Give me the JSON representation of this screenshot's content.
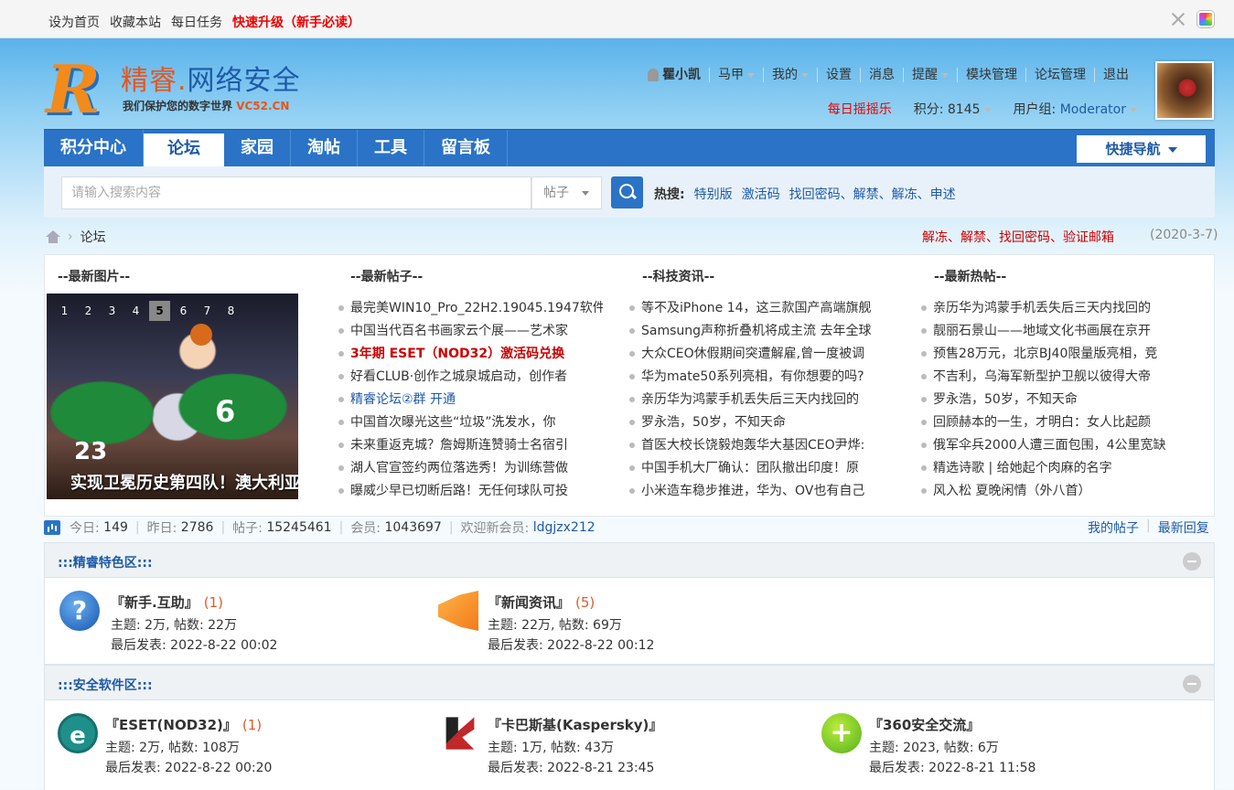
{
  "topbar": {
    "links": [
      "设为首页",
      "收藏本站",
      "每日任务"
    ],
    "upgrade": "快速升级（新手必读）"
  },
  "logo": {
    "letter": "R",
    "title_a": "精睿",
    "title_dot": ".",
    "title_b": "网络安全",
    "sub": "我们保护您的数字世界",
    "url": "VC52.CN"
  },
  "user": {
    "name": "瞿小凯",
    "menu": [
      "马甲",
      "我的",
      "设置",
      "消息",
      "提醒",
      "模块管理",
      "论坛管理",
      "退出"
    ],
    "shake": "每日摇摇乐",
    "points": "积分: 8145",
    "group_label": "用户组: ",
    "group": "Moderator"
  },
  "nav": {
    "items": [
      "积分中心",
      "论坛",
      "家园",
      "淘帖",
      "工具",
      "留言板"
    ],
    "quick": "快捷导航"
  },
  "search": {
    "placeholder": "请输入搜索内容",
    "type": "帖子",
    "hot_label": "热搜:",
    "hot": [
      "特别版",
      "激活码",
      "找回密码、解禁、解冻、申述"
    ]
  },
  "breadcrumb": {
    "current": "论坛"
  },
  "notice": {
    "text": "解冻、解禁、找回密码、验证邮箱",
    "date": "(2020-3-7)"
  },
  "portal": {
    "col1": "--最新图片--",
    "col2": "--最新帖子--",
    "col3": "--科技资讯--",
    "col4": "--最新热帖--",
    "slide_nums": [
      "1",
      "2",
      "3",
      "4",
      "5",
      "6",
      "7",
      "8"
    ],
    "slide_active": "5",
    "slide_caption": "实现卫冕历史第四队！澳大利亚",
    "slide_jersey_a": "6",
    "slide_jersey_b": "23",
    "latest": [
      "最完美WIN10_Pro_22H2.19045.1947软件",
      "中国当代百名书画家云个展——艺术家",
      "3年期 ESET（NOD32）激活码兑换",
      "好看CLUB·创作之城泉城启动，创作者",
      "精睿论坛②群 开通",
      "中国首次曝光这些“垃圾”洗发水，你",
      "未来重返克城？詹姆斯连赞骑士名宿引",
      "湖人官宣签约两位落选秀！为训练营做",
      "曝威少早已切断后路！无任何球队可投"
    ],
    "tech": [
      "等不及iPhone 14，这三款国产高端旗舰",
      "Samsung声称折叠机将成主流 去年全球",
      "大众CEO休假期间突遭解雇,曾一度被调",
      "华为mate50系列亮相，有你想要的吗?",
      "亲历华为鸿蒙手机丢失后三天内找回的",
      "罗永浩，50岁，不知天命",
      "首医大校长饶毅炮轰华大基因CEO尹烨:",
      "中国手机大厂确认：团队撤出印度！原",
      "小米造车稳步推进，华为、OV也有自己"
    ],
    "hot": [
      "亲历华为鸿蒙手机丢失后三天内找回的",
      "靓丽石景山——地域文化书画展在京开",
      "预售28万元，北京BJ40限量版亮相，竞",
      "不吉利，乌海军新型护卫舰以彼得大帝",
      "罗永浩，50岁，不知天命",
      "回顾赫本的一生，才明白：女人比起颜",
      "俄军伞兵2000人遭三面包围，4公里宽缺",
      "精选诗歌 | 给她起个肉麻的名字",
      "风入松 夏晚闲情（外八首）"
    ]
  },
  "stats": {
    "today_label": "今日:",
    "today": "149",
    "yesterday_label": "昨日:",
    "yesterday": "2786",
    "posts_label": "帖子:",
    "posts": "15245461",
    "members_label": "会员:",
    "members": "1043697",
    "newest_label": "欢迎新会员:",
    "newest": "ldgjzx212",
    "my_posts": "我的帖子",
    "latest_reply": "最新回复"
  },
  "sections": [
    {
      "title": ":::精睿特色区:::",
      "forums": [
        {
          "name": "『新手.互助』",
          "count": "(1)",
          "stats": "主题: 2万, 帖数: 22万",
          "last": "最后发表: 2022-8-22 00:02",
          "icon": "help-icon"
        },
        {
          "name": "『新闻资讯』",
          "count": "(5)",
          "stats": "主题: 22万, 帖数: 69万",
          "last": "最后发表: 2022-8-22 00:12",
          "icon": "megaphone-icon"
        }
      ]
    },
    {
      "title": ":::安全软件区:::",
      "forums": [
        {
          "name": "『ESET(NOD32)』",
          "count": "(1)",
          "stats": "主题: 2万, 帖数: 108万",
          "last": "最后发表: 2022-8-22 00:20",
          "icon": "eset-icon"
        },
        {
          "name": "『卡巴斯基(Kaspersky)』",
          "count": "",
          "stats": "主题: 1万, 帖数: 43万",
          "last": "最后发表: 2022-8-21 23:45",
          "icon": "kaspersky-icon"
        },
        {
          "name": "『360安全交流』",
          "count": "",
          "stats": "主题: 2023, 帖数: 6万",
          "last": "最后发表: 2022-8-21 11:58",
          "icon": "360-icon"
        }
      ]
    }
  ]
}
